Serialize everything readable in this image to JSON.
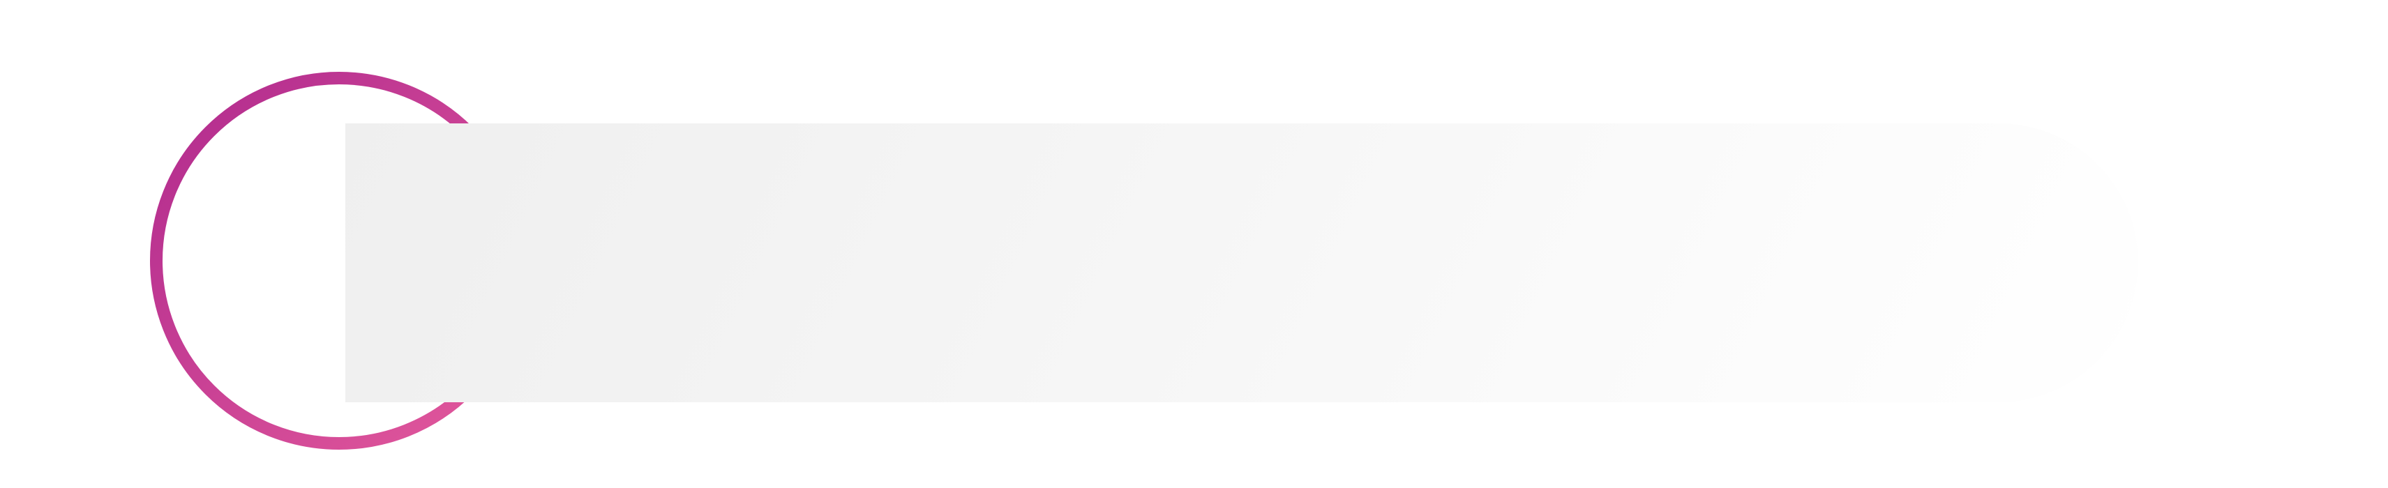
{
  "graphic": {
    "ring_icon": "circle-outline-icon",
    "ring_gradient_start": "#b02a8e",
    "ring_gradient_end": "#e45a9c",
    "banner_gradient_start": "#efefef",
    "banner_gradient_end": "#ffffff"
  },
  "banner": {
    "text": ""
  }
}
